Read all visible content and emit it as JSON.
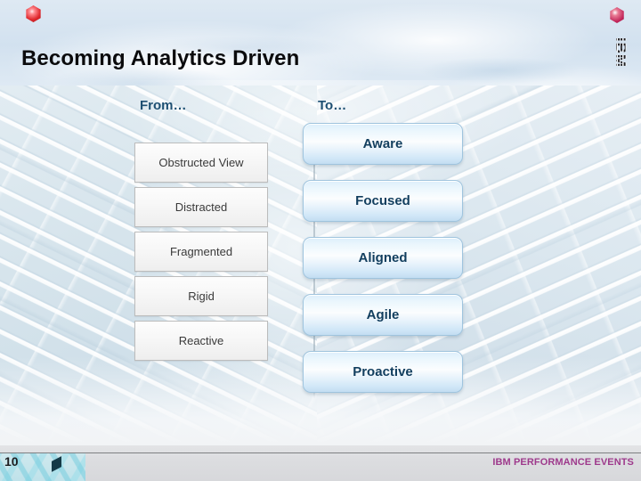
{
  "slide": {
    "title": "Becoming Analytics Driven"
  },
  "columns": {
    "from": {
      "header": "From…",
      "items": [
        {
          "label": "Obstructed View"
        },
        {
          "label": "Distracted"
        },
        {
          "label": "Fragmented"
        },
        {
          "label": "Rigid"
        },
        {
          "label": "Reactive"
        }
      ]
    },
    "to": {
      "header": "To…",
      "items": [
        {
          "label": "Aware"
        },
        {
          "label": "Focused"
        },
        {
          "label": "Aligned"
        },
        {
          "label": "Agile"
        },
        {
          "label": "Proactive"
        }
      ]
    }
  },
  "logo": {
    "wordmark": "IBM",
    "mark_icon": "ibm-gem-icon"
  },
  "footer": {
    "page_number": "10",
    "brand": "IBM PERFORMANCE EVENTS",
    "art_icon": "isometric-cubes-icon",
    "gem_icon": "red-gem-icon"
  },
  "colors": {
    "title": "#0b0b0d",
    "column_header": "#1d4f72",
    "from_box_text": "#3a3a3a",
    "to_box_text": "#123e5e",
    "to_box_border": "#9fc4de",
    "brand": "#9e3a8c",
    "footer_bg": "#dcdde0"
  }
}
